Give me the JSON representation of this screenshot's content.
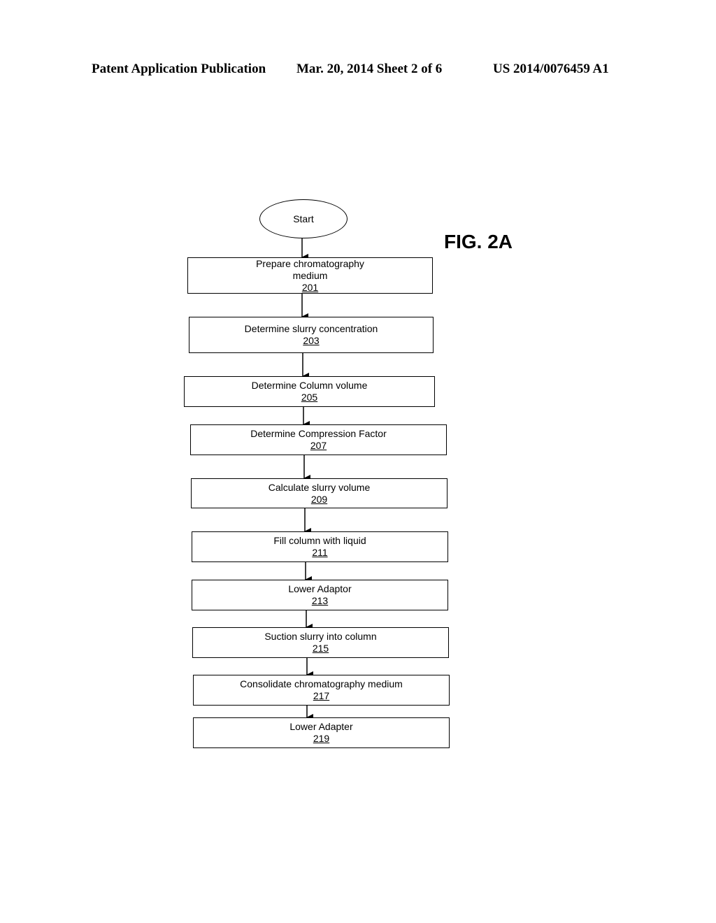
{
  "header": {
    "left": "Patent Application Publication",
    "middle": "Mar. 20, 2014  Sheet 2 of 6",
    "right": "US 2014/0076459 A1"
  },
  "figure_label": "FIG. 2A",
  "flowchart": {
    "start": "Start",
    "steps": [
      {
        "text": "Prepare chromatography medium",
        "text_line1": "Prepare chromatography",
        "text_line2": "medium",
        "number": "201"
      },
      {
        "text": "Determine slurry concentration",
        "number": "203"
      },
      {
        "text": "Determine Column volume",
        "number": "205"
      },
      {
        "text": "Determine Compression Factor",
        "number": "207"
      },
      {
        "text": "Calculate slurry volume",
        "number": "209"
      },
      {
        "text": "Fill column with liquid",
        "number": "211"
      },
      {
        "text": "Lower Adaptor",
        "number": "213"
      },
      {
        "text": "Suction slurry into column",
        "number": "215"
      },
      {
        "text": "Consolidate chromatography medium",
        "number": "217"
      },
      {
        "text": "Lower Adapter",
        "number": "219"
      }
    ]
  }
}
